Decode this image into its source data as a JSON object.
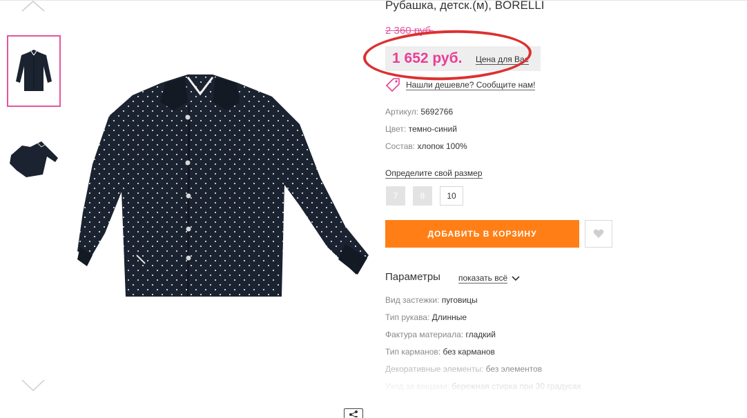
{
  "product": {
    "title": "Рубашка, детск.(м), BORELLI",
    "old_price": "2 360 руб.",
    "price": "1 652 руб.",
    "price_note": "Цена для Вас",
    "cheaper_link": "Нашли дешевле? Сообщите нам!",
    "specs": [
      {
        "key": "Артикул:",
        "value": "5692766"
      },
      {
        "key": "Цвет:",
        "value": "темно-синий"
      },
      {
        "key": "Состав:",
        "value": "хлопок 100%"
      }
    ]
  },
  "sizes": {
    "link": "Определите свой размер",
    "options": [
      {
        "label": "7",
        "available": false
      },
      {
        "label": "8",
        "available": false
      },
      {
        "label": "10",
        "available": true,
        "selected": true
      }
    ]
  },
  "actions": {
    "add_to_cart": "ДОБАВИТЬ В КОРЗИНУ"
  },
  "parameters": {
    "title": "Параметры",
    "show_all": "показать всё",
    "items": [
      {
        "key": "Вид застежки:",
        "value": "пуговицы"
      },
      {
        "key": "Тип рукава:",
        "value": "Длинные"
      },
      {
        "key": "Фактура материала:",
        "value": "гладкий"
      },
      {
        "key": "Тип карманов:",
        "value": "без карманов"
      },
      {
        "key": "Декоративные элементы:",
        "value": "без элементов"
      },
      {
        "key": "Уход за вещами:",
        "value": "бережная стирка при 30 градусах"
      }
    ]
  },
  "colors": {
    "accent_pink": "#e93d94",
    "cart_orange": "#ff7f16",
    "highlight_red": "#dc3030",
    "shirt_navy": "#1b2330"
  },
  "icons": {
    "gallery_up": "chevron-up-icon",
    "gallery_down": "chevron-down-icon",
    "tag": "price-tag-icon",
    "favorite": "heart-icon",
    "share": "share-icon"
  }
}
